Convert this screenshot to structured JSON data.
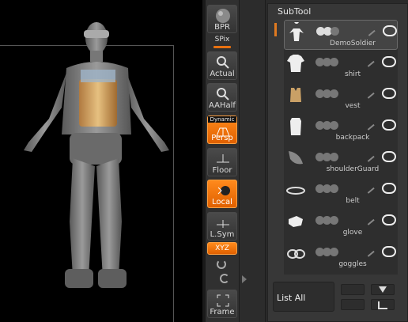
{
  "shelf": {
    "bpr_label": "BPR",
    "spix_label": "SPix",
    "actual_label": "Actual",
    "aahalf_label": "AAHalf",
    "dynamic_label": "Dynamic",
    "persp_label": "Persp",
    "floor_label": "Floor",
    "local_label": "Local",
    "lsym_label": "L.Sym",
    "xyz_label": "XYZ",
    "frame_label": "Frame",
    "accent_color": "#e87110"
  },
  "subtool": {
    "title": "SubTool",
    "items": [
      {
        "name": "DemoSoldier",
        "icon": "soldier-thumb-icon",
        "selected": true
      },
      {
        "name": "shirt",
        "icon": "shirt-thumb-icon"
      },
      {
        "name": "vest",
        "icon": "vest-thumb-icon"
      },
      {
        "name": "backpack",
        "icon": "backpack-thumb-icon"
      },
      {
        "name": "shoulderGuard",
        "icon": "shoulder-guard-thumb-icon"
      },
      {
        "name": "belt",
        "icon": "belt-thumb-icon"
      },
      {
        "name": "glove",
        "icon": "glove-thumb-icon"
      },
      {
        "name": "goggles",
        "icon": "goggles-thumb-icon"
      }
    ],
    "list_all_label": "List  All"
  }
}
